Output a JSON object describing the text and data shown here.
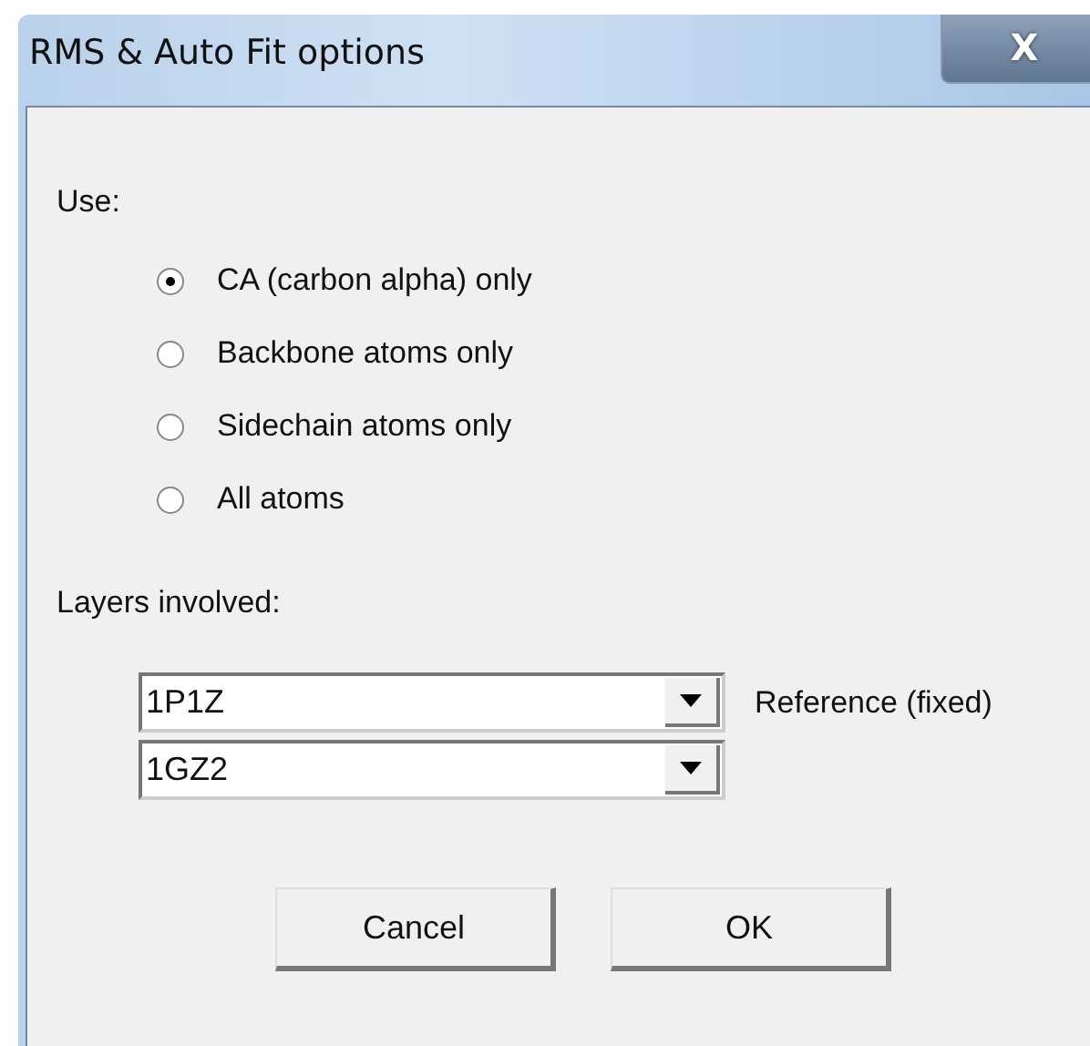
{
  "window": {
    "title": "RMS & Auto Fit options",
    "close": "X"
  },
  "use": {
    "label": "Use:",
    "options": [
      {
        "label": "CA (carbon alpha) only",
        "selected": true
      },
      {
        "label": "Backbone atoms only",
        "selected": false
      },
      {
        "label": "Sidechain atoms only",
        "selected": false
      },
      {
        "label": "All atoms",
        "selected": false
      }
    ]
  },
  "layers": {
    "label": "Layers involved:",
    "combos": [
      {
        "value": "1P1Z",
        "note": "Reference (fixed)"
      },
      {
        "value": "1GZ2"
      }
    ]
  },
  "buttons": [
    "Cancel",
    "OK"
  ]
}
